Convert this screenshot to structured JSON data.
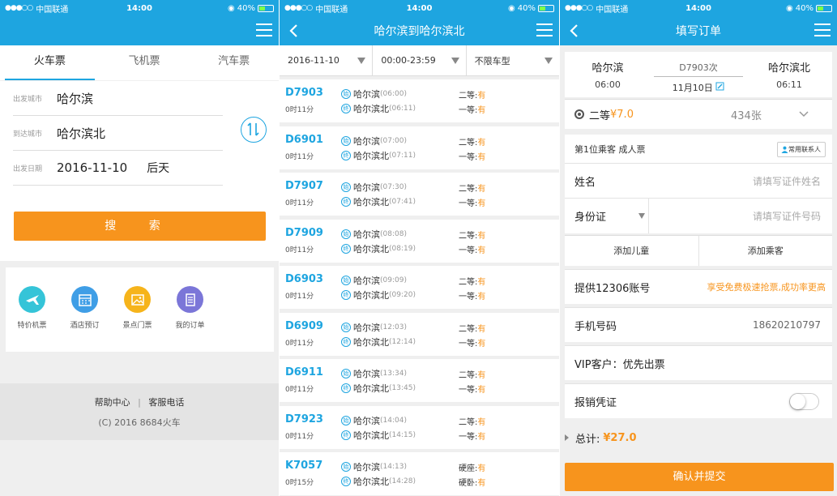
{
  "status": {
    "carrier": "中国联通",
    "time": "14:00",
    "battery": "40%",
    "battery_level": 0.4
  },
  "search_screen": {
    "tabs": [
      "火车票",
      "飞机票",
      "汽车票"
    ],
    "from_label": "出发城市",
    "from_value": "哈尔滨",
    "to_label": "到达城市",
    "to_value": "哈尔滨北",
    "date_label": "出发日期",
    "date_value": "2016-11-10",
    "date_extra": "后天",
    "search_button": "搜 索",
    "quick": [
      {
        "label": "特价机票",
        "icon": "plane-icon",
        "color": "#35c4d8"
      },
      {
        "label": "酒店预订",
        "icon": "calendar-icon",
        "color": "#3f9ee6"
      },
      {
        "label": "景点门票",
        "icon": "image-icon",
        "color": "#f6b41b"
      },
      {
        "label": "我的订单",
        "icon": "list-icon",
        "color": "#7b76d8"
      }
    ],
    "footer_help": "帮助中心",
    "footer_sep": "|",
    "footer_phone": "客服电话",
    "copyright": "(C) 2016 8684火车"
  },
  "list_screen": {
    "title": "哈尔滨到哈尔滨北",
    "filters": [
      "2016-11-10",
      "00:00-23:59",
      "不限车型"
    ],
    "trains": [
      {
        "no": "D7903",
        "dur": "0时11分",
        "dep": "哈尔滨",
        "dep_t": "(06:00)",
        "arr": "哈尔滨北",
        "arr_t": "(06:11)",
        "s1": "二等:",
        "a1": "有",
        "s2": "一等:",
        "a2": "有"
      },
      {
        "no": "D6901",
        "dur": "0时11分",
        "dep": "哈尔滨",
        "dep_t": "(07:00)",
        "arr": "哈尔滨北",
        "arr_t": "(07:11)",
        "s1": "二等:",
        "a1": "有",
        "s2": "一等:",
        "a2": "有"
      },
      {
        "no": "D7907",
        "dur": "0时11分",
        "dep": "哈尔滨",
        "dep_t": "(07:30)",
        "arr": "哈尔滨北",
        "arr_t": "(07:41)",
        "s1": "二等:",
        "a1": "有",
        "s2": "一等:",
        "a2": "有"
      },
      {
        "no": "D7909",
        "dur": "0时11分",
        "dep": "哈尔滨",
        "dep_t": "(08:08)",
        "arr": "哈尔滨北",
        "arr_t": "(08:19)",
        "s1": "二等:",
        "a1": "有",
        "s2": "一等:",
        "a2": "有"
      },
      {
        "no": "D6903",
        "dur": "0时11分",
        "dep": "哈尔滨",
        "dep_t": "(09:09)",
        "arr": "哈尔滨北",
        "arr_t": "(09:20)",
        "s1": "二等:",
        "a1": "有",
        "s2": "一等:",
        "a2": "有"
      },
      {
        "no": "D6909",
        "dur": "0时11分",
        "dep": "哈尔滨",
        "dep_t": "(12:03)",
        "arr": "哈尔滨北",
        "arr_t": "(12:14)",
        "s1": "二等:",
        "a1": "有",
        "s2": "一等:",
        "a2": "有"
      },
      {
        "no": "D6911",
        "dur": "0时11分",
        "dep": "哈尔滨",
        "dep_t": "(13:34)",
        "arr": "哈尔滨北",
        "arr_t": "(13:45)",
        "s1": "二等:",
        "a1": "有",
        "s2": "一等:",
        "a2": "有"
      },
      {
        "no": "D7923",
        "dur": "0时11分",
        "dep": "哈尔滨",
        "dep_t": "(14:04)",
        "arr": "哈尔滨北",
        "arr_t": "(14:15)",
        "s1": "二等:",
        "a1": "有",
        "s2": "一等:",
        "a2": "有"
      },
      {
        "no": "K7057",
        "dur": "0时15分",
        "dep": "哈尔滨",
        "dep_t": "(14:13)",
        "arr": "哈尔滨北",
        "arr_t": "(14:28)",
        "s1": "硬座:",
        "a1": "有",
        "s2": "硬卧:",
        "a2": "有"
      }
    ]
  },
  "order_screen": {
    "title": "填写订单",
    "from": "哈尔滨",
    "from_time": "06:00",
    "train_no": "D7903次",
    "date": "11月10日",
    "to": "哈尔滨北",
    "to_time": "06:11",
    "seat_name": "二等",
    "seat_price": "¥7.0",
    "seat_count": "434张",
    "passenger_head": "第1位乘客 成人票",
    "contact_button": "常用联系人",
    "name_label": "姓名",
    "name_placeholder": "请填写证件姓名",
    "id_label": "身份证",
    "id_placeholder": "请填写证件号码",
    "add_child": "添加儿童",
    "add_passenger": "添加乘客",
    "account_label": "提供12306账号",
    "account_promo": "享受免费极速抢票,成功率更高",
    "phone_label": "手机号码",
    "phone_value": "18620210797",
    "vip_label": "VIP客户：",
    "vip_value": "优先出票",
    "receipt_label": "报销凭证",
    "receipt_on": false,
    "total_label": "总计:",
    "total_value": "¥27.0",
    "submit": "确认并提交"
  },
  "colors": {
    "primary": "#1ea5e0",
    "accent": "#f7941d"
  }
}
